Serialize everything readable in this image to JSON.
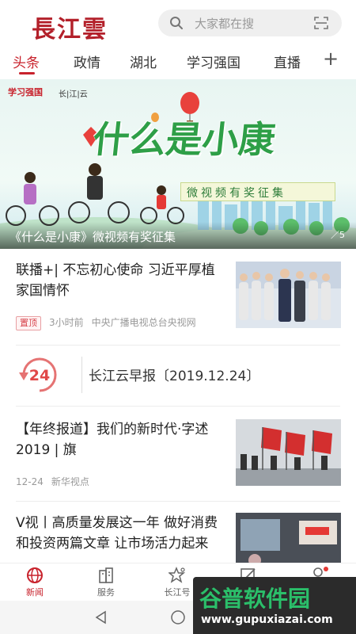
{
  "header": {
    "logo": "長江雲",
    "search_placeholder": "大家都在搜"
  },
  "tabs": [
    {
      "label": "头条",
      "active": true
    },
    {
      "label": "政情"
    },
    {
      "label": "湖北"
    },
    {
      "label": "学习强国"
    },
    {
      "label": "直播"
    }
  ],
  "banner": {
    "brand_a": "学习强国",
    "brand_b": "长|江|云",
    "title": "什么是小康",
    "subtitle": "微视频有奖征集",
    "caption": "《什么是小康》微视频有奖征集",
    "page_indicator": "5"
  },
  "news": [
    {
      "title": "联播+| 不忘初心使命 习近平厚植家国情怀",
      "badge": "置顶",
      "time": "3小时前",
      "source": "中央广播电视总台央视网"
    },
    {
      "title": "【年终报道】我们的新时代·字述2019 | 旗",
      "time": "12-24",
      "source": "新华视点"
    },
    {
      "title": "V视丨高质量发展这一年 做好消费和投资两篇文章 让市场活力起来"
    }
  ],
  "report": {
    "icon_text": "24",
    "label": "长江云早报〔2019.12.24〕"
  },
  "bottom_nav": [
    {
      "label": "新闻",
      "icon": "globe-icon",
      "active": true
    },
    {
      "label": "服务",
      "icon": "building-icon"
    },
    {
      "label": "长江号",
      "icon": "star-people-icon"
    },
    {
      "label": "",
      "icon": "edit-icon"
    },
    {
      "label": "",
      "icon": "user-icon"
    }
  ],
  "watermark": {
    "line1": "谷普软件园",
    "line2": "www.gupuxiazai.com"
  },
  "colors": {
    "accent": "#c8222c",
    "banner_green": "#2e9f47"
  }
}
